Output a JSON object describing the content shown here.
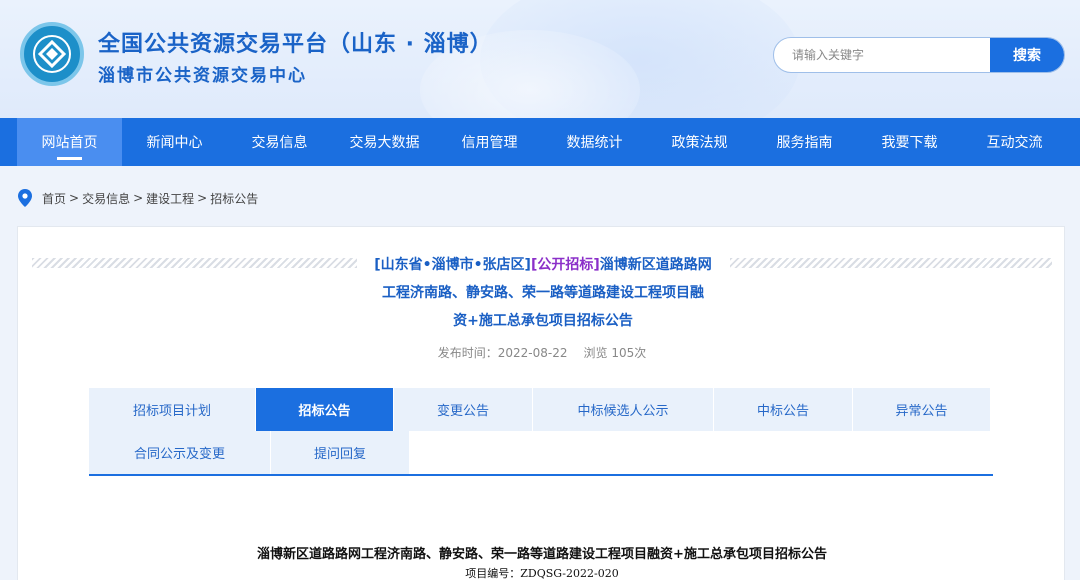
{
  "header": {
    "title": "全国公共资源交易平台（山东 · 淄博）",
    "subtitle": "淄博市公共资源交易中心",
    "search_placeholder": "请输入关键字",
    "search_button": "搜索"
  },
  "nav": {
    "items": [
      {
        "label": "网站首页",
        "active": true
      },
      {
        "label": "新闻中心"
      },
      {
        "label": "交易信息"
      },
      {
        "label": "交易大数据"
      },
      {
        "label": "信用管理"
      },
      {
        "label": "数据统计"
      },
      {
        "label": "政策法规"
      },
      {
        "label": "服务指南"
      },
      {
        "label": "我要下载"
      },
      {
        "label": "互动交流"
      }
    ]
  },
  "breadcrumb": {
    "items": [
      "首页",
      "交易信息",
      "建设工程",
      "招标公告"
    ],
    "separator": ">"
  },
  "article": {
    "region_tag": "[山东省•淄博市•张店区]",
    "type_tag": "[公开招标]",
    "title_line1": "淄博新区道路路网",
    "title_line2": "工程济南路、静安路、荣一路等道路建设工程项目融",
    "title_line3": "资+施工总承包项目招标公告",
    "publish_label": "发布时间：2022-08-22",
    "views_label": "浏览 105次"
  },
  "tabs": {
    "row1": [
      "招标项目计划",
      "招标公告",
      "变更公告",
      "中标候选人公示",
      "中标公告",
      "异常公告"
    ],
    "row2": [
      "合同公示及变更",
      "提问回复"
    ],
    "active": "招标公告"
  },
  "document": {
    "title": "淄博新区道路路网工程济南路、静安路、荣一路等道路建设工程项目融资+施工总承包项目招标公告",
    "project_no": "项目编号：ZDQSG-2022-020"
  },
  "colors": {
    "primary": "#1b6fe0",
    "title_blue": "#1a63c7",
    "tag_purple": "#8b2fc9",
    "tab_bg": "#e9f1fb"
  }
}
